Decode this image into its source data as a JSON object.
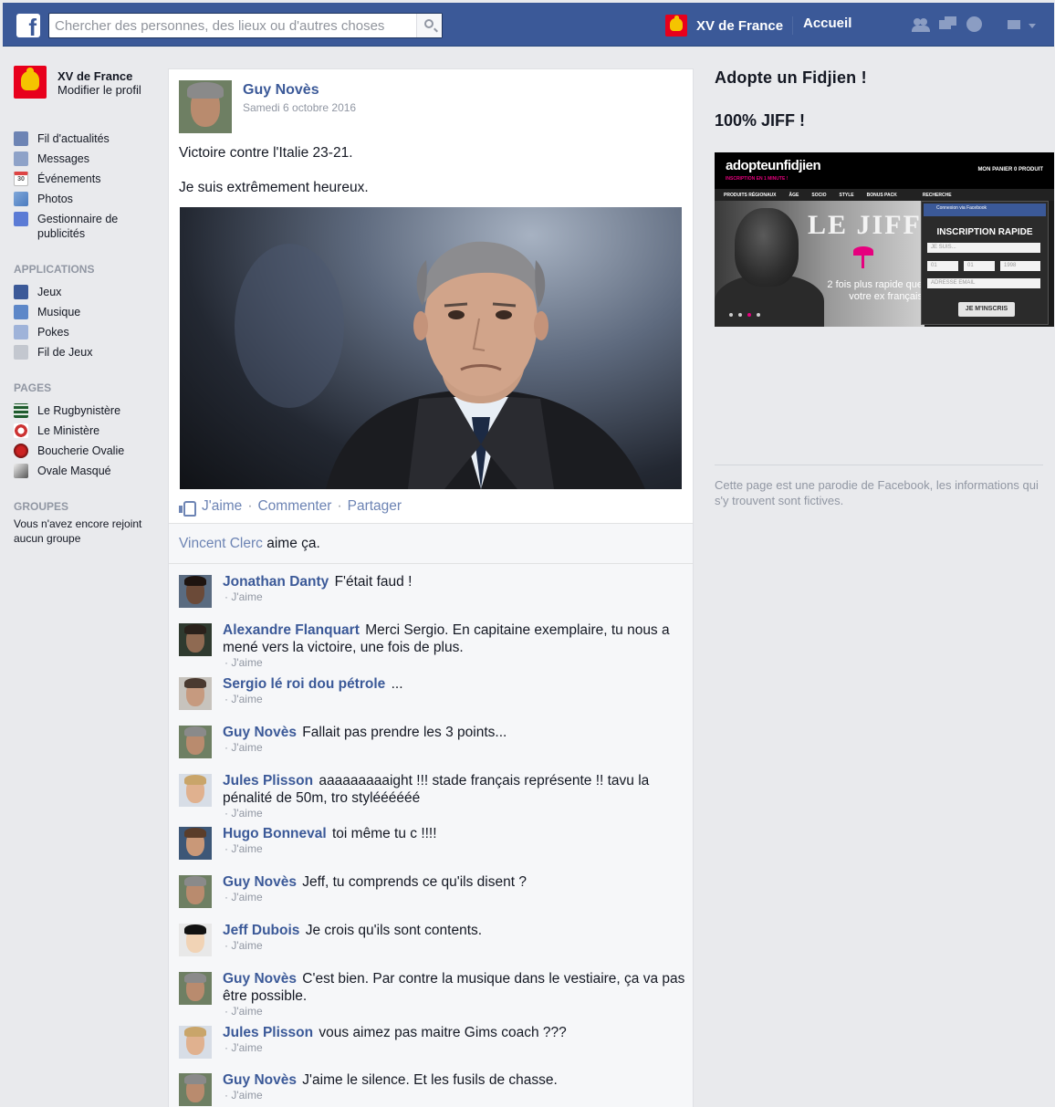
{
  "header": {
    "search_placeholder": "Chercher des personnes, des lieux ou d'autres choses",
    "profile_name": "XV de France",
    "home_label": "Accueil"
  },
  "sidebar": {
    "profile_name": "XV de France",
    "edit_profile": "Modifier le profil",
    "main_items": [
      {
        "label": "Fil d'actualités",
        "icon": "news-feed-icon"
      },
      {
        "label": "Messages",
        "icon": "messages-icon"
      },
      {
        "label": "Événements",
        "icon": "calendar-icon"
      },
      {
        "label": "Photos",
        "icon": "photos-icon"
      },
      {
        "label": "Gestionnaire de publicités",
        "icon": "ads-manager-icon"
      }
    ],
    "apps_title": "APPLICATIONS",
    "apps": [
      {
        "label": "Jeux",
        "icon": "games-icon"
      },
      {
        "label": "Musique",
        "icon": "music-icon"
      },
      {
        "label": "Pokes",
        "icon": "pokes-icon"
      },
      {
        "label": "Fil de Jeux",
        "icon": "game-feed-icon"
      }
    ],
    "pages_title": "PAGES",
    "pages": [
      {
        "label": "Le Rugbynistère"
      },
      {
        "label": "Le Ministère"
      },
      {
        "label": "Boucherie Ovalie"
      },
      {
        "label": "Ovale Masqué"
      }
    ],
    "groups_title": "GROUPES",
    "groups_note": "Vous n'avez encore rejoint aucun groupe"
  },
  "post": {
    "author": "Guy Novès",
    "date": "Samedi 6 octobre 2016",
    "text_line1": "Victoire contre l'Italie 23-21.",
    "text_line2": "Je suis extrêmement heureux.",
    "actions": {
      "like": "J'aime",
      "comment": "Commenter",
      "share": "Partager",
      "separator": "·"
    },
    "likes": {
      "who": "Vincent Clerc",
      "suffix": "aime ça."
    }
  },
  "comments": [
    {
      "author": "Jonathan Danty",
      "text": "F'était faud !",
      "like": "· J'aime"
    },
    {
      "author": "Alexandre Flanquart",
      "text": "Merci Sergio. En capitaine exemplaire, tu nous a mené vers la victoire, une fois de plus.",
      "like": "· J'aime"
    },
    {
      "author": "Sergio lé roi dou pétrole",
      "text": "...",
      "like": "· J'aime"
    },
    {
      "author": "Guy Novès",
      "text": "Fallait pas prendre les 3 points...",
      "like": "· J'aime"
    },
    {
      "author": "Jules Plisson",
      "text": "aaaaaaaaaight !!! stade français représente !! tavu la pénalité de 50m, tro styléééééé",
      "like": "· J'aime"
    },
    {
      "author": "Hugo Bonneval",
      "text": "toi même tu c !!!!",
      "like": "· J'aime"
    },
    {
      "author": "Guy Novès",
      "text": "Jeff, tu comprends ce qu'ils disent ?",
      "like": "· J'aime"
    },
    {
      "author": "Jeff Dubois",
      "text": "Je crois qu'ils sont contents.",
      "like": "· J'aime"
    },
    {
      "author": "Guy Novès",
      "text": "C'est bien. Par contre la musique dans le vestiaire, ça va pas être possible.",
      "like": "· J'aime"
    },
    {
      "author": "Jules Plisson",
      "text": "vous aimez pas maitre Gims coach ???",
      "like": "· J'aime"
    },
    {
      "author": "Guy Novès",
      "text": "J'aime le silence. Et les fusils de chasse.",
      "like": "· J'aime"
    }
  ],
  "right": {
    "ad_title": "Adopte un Fidjien !",
    "ad_subtitle": "100% JIFF !",
    "ad": {
      "logo": "adopteunfidjien",
      "tagline": "INSCRIPTION EN 1 MINUTE !",
      "cart": "MON PANIER 0 PRODUIT",
      "menu": [
        "PRODUITS RÉGIONAUX",
        "ÂGE",
        "SOCIO",
        "STYLE",
        "BONUS PACK",
        "RECHERCHE"
      ],
      "headline": "LE JIFF",
      "slogan": "2 fois plus rapide que votre ex français",
      "fb_connect": "Connexion via Facebook",
      "form_title": "INSCRIPTION RAPIDE",
      "field_gender": "JE SUIS...",
      "field_day": "01",
      "field_month": "01",
      "field_year": "1998",
      "field_email": "ADRESSE EMAIL",
      "button": "JE M'INSCRIS"
    },
    "disclaimer": "Cette page est une parodie de Facebook, les informations qui s'y trouvent sont fictives."
  },
  "colors": {
    "brand": "#3b5998",
    "link": "#6d84b4",
    "muted": "#9197a3",
    "background": "#e9eaed"
  }
}
